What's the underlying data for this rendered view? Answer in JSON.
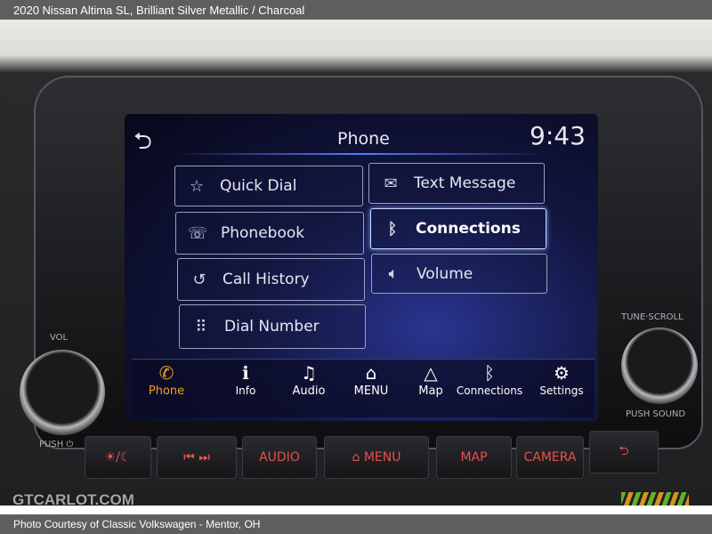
{
  "header": {
    "title": "2020 Nissan Altima SL,  Brilliant Silver Metallic / Charcoal"
  },
  "footer": {
    "credit": "Photo Courtesy of Classic Volkswagen - Mentor, OH"
  },
  "watermark": {
    "text": "GTCARLOT.COM"
  },
  "screen": {
    "title": "Phone",
    "time": "9:43",
    "buttons": [
      {
        "label": "Quick Dial",
        "icon": "star-icon"
      },
      {
        "label": "Text Message",
        "icon": "envelope-icon"
      },
      {
        "label": "Phonebook",
        "icon": "phonebook-icon"
      },
      {
        "label": "Connections",
        "icon": "bluetooth-icon",
        "selected": true
      },
      {
        "label": "Call History",
        "icon": "call-history-icon"
      },
      {
        "label": "Volume",
        "icon": "speaker-icon"
      },
      {
        "label": "Dial Number",
        "icon": "keypad-icon"
      }
    ],
    "bottom_bar": [
      {
        "label": "Phone",
        "icon": "phone-icon",
        "active": true
      },
      {
        "label": "Info",
        "icon": "info-icon"
      },
      {
        "label": "Audio",
        "icon": "music-icon"
      },
      {
        "label": "MENU",
        "icon": "home-icon"
      },
      {
        "label": "Map",
        "icon": "navigation-icon"
      },
      {
        "label": "Connections",
        "icon": "bluetooth-icon"
      },
      {
        "label": "Settings",
        "icon": "gear-icon"
      }
    ],
    "accent": "#f0a020"
  },
  "physical": {
    "buttons": [
      "☀/☾",
      "⏮  ⏭",
      "AUDIO",
      "⌂ MENU",
      "MAP",
      "CAMERA",
      "⮌"
    ],
    "vol_label": "VOL",
    "push_power_label": "PUSH ⏻",
    "tune_label": "TUNE·SCROLL",
    "push_sound_label": "PUSH SOUND"
  }
}
